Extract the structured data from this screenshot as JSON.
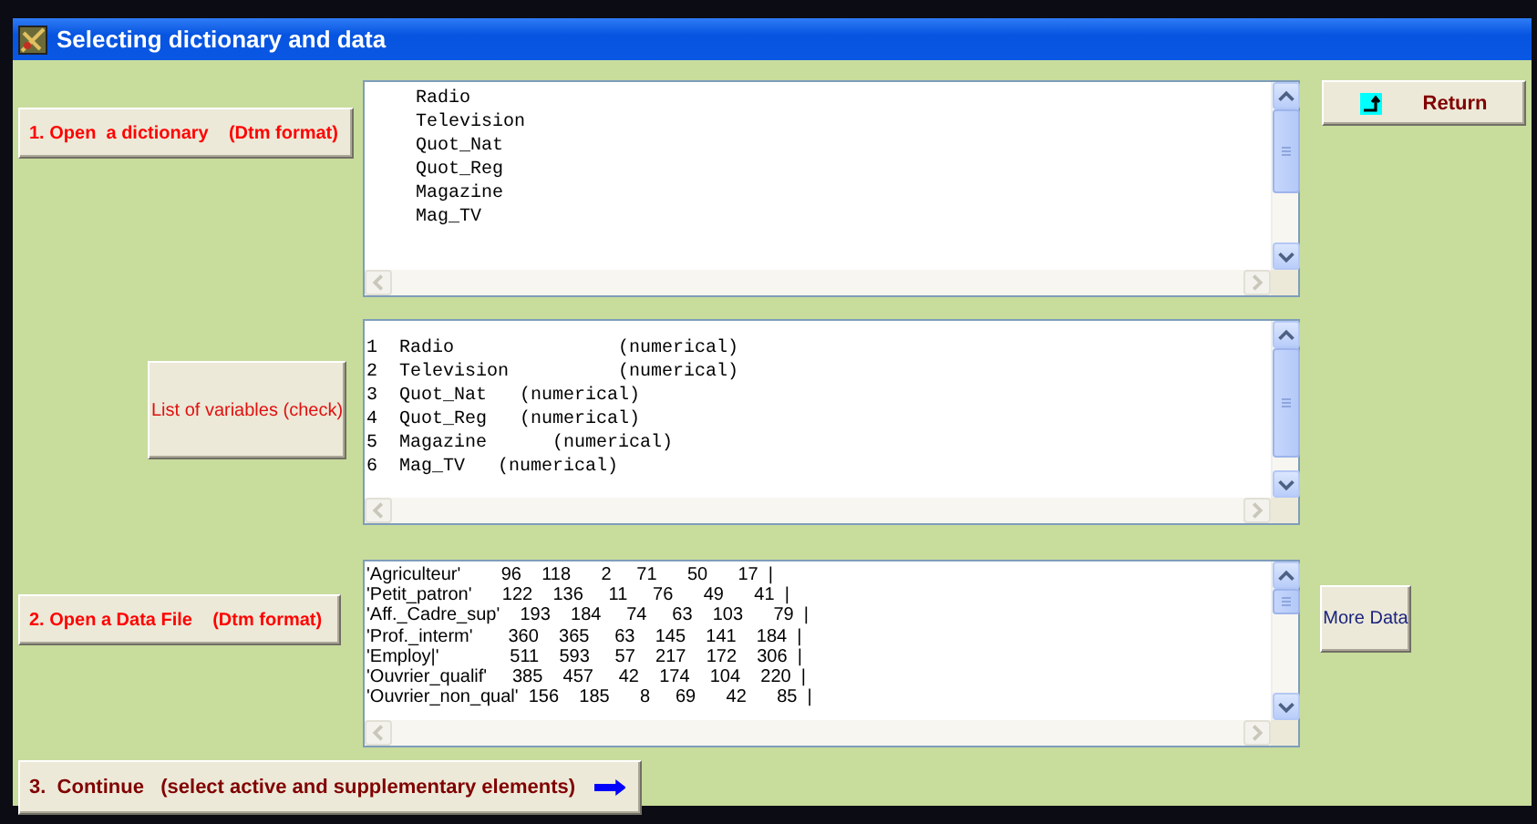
{
  "window": {
    "title": "Selecting dictionary and data"
  },
  "dictionary": {
    "button": "1. Open  a dictionary    (Dtm format)",
    "lines": [
      "Radio",
      "Television",
      "Quot_Nat",
      "Quot_Reg",
      "Magazine",
      "Mag_TV"
    ]
  },
  "return_button": "Return",
  "variables": {
    "button": "List of variables (check)",
    "lines": [
      "1  Radio               (numerical)",
      "2  Television          (numerical)",
      "3  Quot_Nat   (numerical)",
      "4  Quot_Reg   (numerical)",
      "5  Magazine      (numerical)",
      "6  Mag_TV   (numerical)"
    ]
  },
  "data_file": {
    "button": "2. Open a Data File    (Dtm format)",
    "lines": [
      "'Agriculteur'        96    118      2     71      50      17  |",
      "'Petit_patron'      122    136     11     76      49      41  |",
      "'Aff._Cadre_sup'    193    184     74     63    103      79  |",
      "'Prof._interm'       360    365     63    145    141    184  |",
      "'Employ|'              511    593     57    217    172    306  |",
      "'Ouvrier_qualif'     385    457     42    174    104    220  |",
      "'Ouvrier_non_qual'  156    185      8     69      42      85  |"
    ]
  },
  "more_data_button": "More Data",
  "continue_button": "3.  Continue   (select active and supplementary elements)"
}
